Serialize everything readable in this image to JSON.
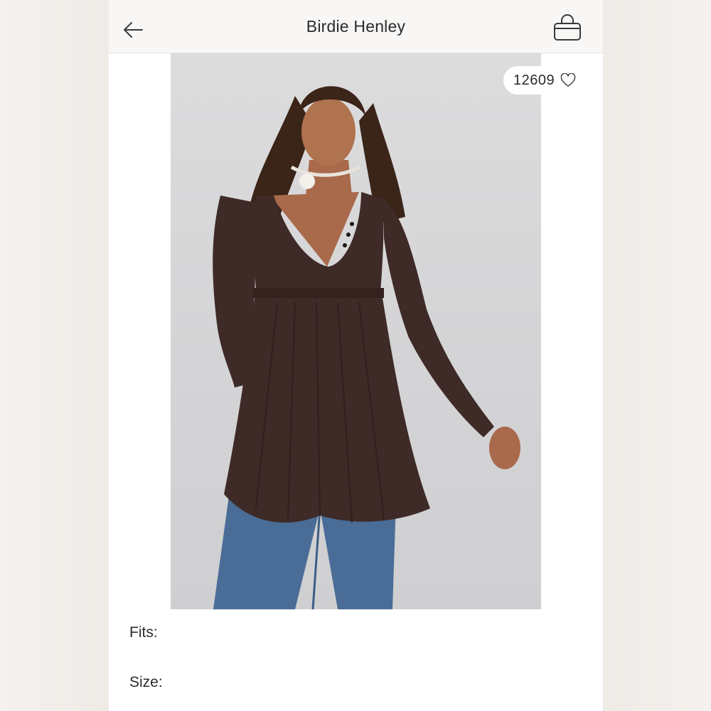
{
  "header": {
    "title": "Birdie Henley",
    "back_icon": "arrow-left-icon",
    "bag_icon": "shopping-bag-icon"
  },
  "product": {
    "image_description": "Model wearing a long-sleeve dark brown henley tunic with babydoll pleats, paired with blue jeans",
    "likes": "12609",
    "like_icon": "heart-outline-icon"
  },
  "details": {
    "fits_label": "Fits:",
    "size_label": "Size:"
  },
  "colors": {
    "background": "#f3f0ec",
    "header_bg": "#f9f7f5",
    "text": "#2b2b2b",
    "garment": "#3e2a26",
    "photo_bg": "#d6d6d8"
  }
}
